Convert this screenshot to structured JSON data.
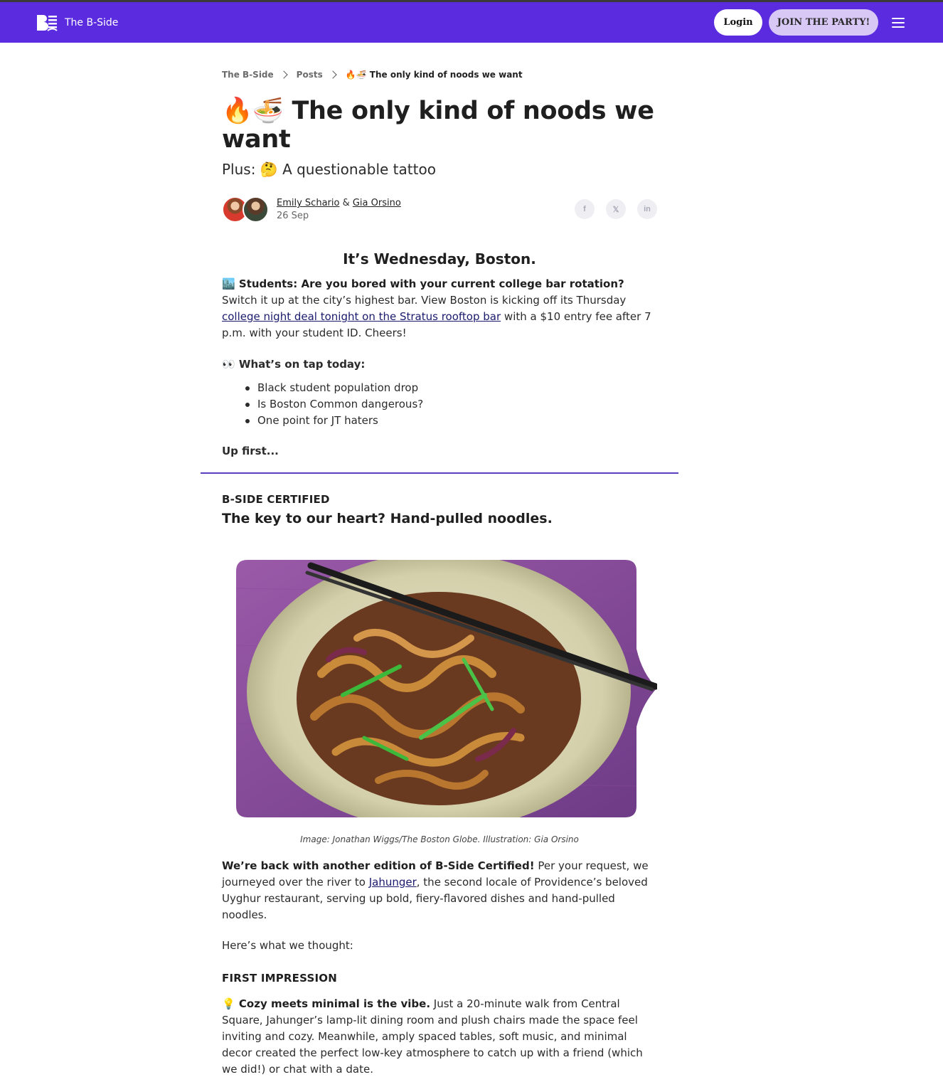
{
  "nav": {
    "brand": "The B-Side",
    "login": "Login",
    "join": "JOIN THE PARTY!",
    "menu_icon": "hamburger-icon"
  },
  "breadcrumb": {
    "home": "The B-Side",
    "posts": "Posts",
    "current": "🔥🍜 The only kind of noods we want"
  },
  "article": {
    "title": "🔥🍜 The only kind of noods we want",
    "subtitle": "Plus: 🤔 A questionable tattoo",
    "author1": "Emily Schario",
    "amp": " & ",
    "author2": "Gia Orsino",
    "date": "26 Sep",
    "share": [
      "f",
      "𝕏",
      "in"
    ],
    "greeting": "It’s Wednesday, Boston.",
    "p1_lead": "🏙️ Students: Are you bored with your current college bar rotation?",
    "p1_text": " Switch it up at the city’s highest bar. View Boston is kicking off its Thursday ",
    "p1_link": "college night deal tonight on the Stratus rooftop bar",
    "p1_tail": " with a $10 entry fee after 7 p.m. with your student ID. Cheers!",
    "ontap": "👀 What’s on tap today:",
    "bullets": [
      "Black student population drop",
      "Is Boston Common dangerous?",
      "One point for JT haters"
    ],
    "upfirst": "Up first..."
  },
  "section": {
    "kicker": "B-SIDE CERTIFIED",
    "title": "The key to our heart? Hand-pulled noodles.",
    "caption": "Image: Jonathan Wiggs/The Boston Globe. Illustration: Gia Orsino",
    "p3_lead": "We’re back with another edition of B-Side Certified!",
    "p3_text": " Per your request, we journeyed over the river to ",
    "p3_link": "Jahunger",
    "p3_tail": ", the second locale of Providence’s beloved Uyghur restaurant, serving up bold, fiery-flavored dishes and hand-pulled noodles.",
    "p4": "Here’s what we thought:",
    "impression": "FIRST IMPRESSION",
    "p5_lead": "💡 Cozy meets minimal is the vibe.",
    "p5_text": " Just a 20-minute walk from Central Square, Jahunger’s lamp-lit dining room and plush chairs made the space feel inviting and cozy. Meanwhile, amply spaced tables, soft music, and minimal decor created the perfect low-key atmosphere to catch up with a friend (which we did!) or chat with a date."
  },
  "colors": {
    "nav_bg": "#5b2be0",
    "join_bg": "#d8c8f5",
    "divider": "#5b3fc0",
    "link": "#1a1a6e"
  }
}
